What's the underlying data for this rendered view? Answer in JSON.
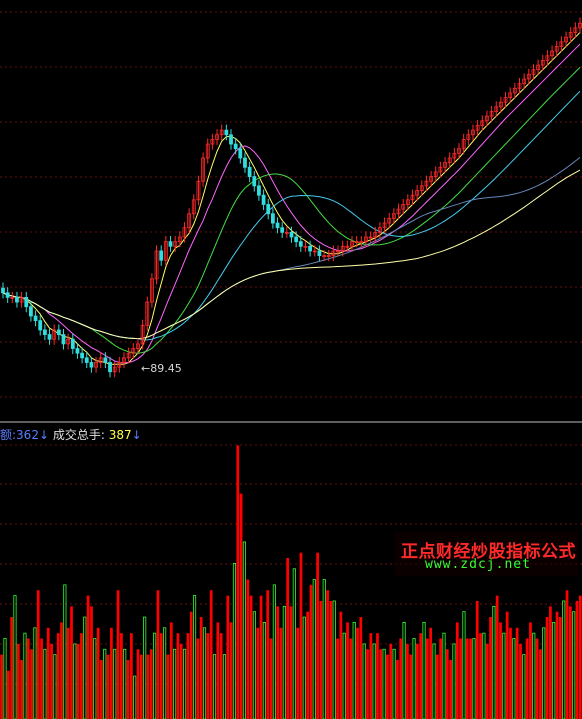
{
  "price_panel": {
    "low_marker": "89.45"
  },
  "volume_panel": {
    "frag_label": "额:",
    "frag_value": "362",
    "total_label": "成交总手:",
    "total_value": "387",
    "arrow": "↓"
  },
  "watermark": {
    "title": "正点财经炒股指标公式",
    "url": "www.zdcj.net"
  },
  "colors": {
    "background": "#000000",
    "up_candle": "#ff2a2a",
    "down_candle": "#33dddd",
    "vol_up": "#ff0000",
    "vol_down_outline": "#33ff33",
    "grid": "#6a1010",
    "divider": "#bbbbbb",
    "ma_white": "#dddddd",
    "ma_yellow": "#ffff66",
    "ma_magenta": "#ff66ff",
    "ma_green": "#44dd44",
    "ma_cyan": "#44ccee",
    "ma_slate": "#6688bb",
    "ma_cream": "#ffffaa"
  },
  "chart_data": [
    {
      "type": "candlestick",
      "title": "",
      "annotations": [
        {
          "text": "89.45",
          "meaning": "period low"
        }
      ],
      "closes": [
        107,
        106,
        106,
        105,
        106,
        104,
        102,
        101,
        99,
        98,
        97,
        99,
        98,
        96,
        97,
        95,
        94,
        93,
        92,
        91,
        92,
        93,
        92,
        90,
        91,
        92,
        93,
        94,
        95,
        96,
        100,
        105,
        110,
        116,
        114,
        118,
        117,
        118,
        119,
        121,
        124,
        127,
        131,
        136,
        139,
        140,
        141,
        142,
        141,
        139,
        138,
        136,
        134,
        132,
        130,
        128,
        126,
        124,
        122,
        121,
        120,
        120,
        119,
        118,
        117,
        117,
        116,
        116,
        115,
        115,
        115,
        116,
        116,
        117,
        117,
        118,
        118,
        118,
        119,
        119,
        120,
        121,
        122,
        123,
        124,
        125,
        126,
        127,
        128,
        129,
        130,
        131,
        132,
        133,
        134,
        135,
        136,
        137,
        138,
        140,
        141,
        142,
        143,
        144,
        145,
        146,
        147,
        148,
        149,
        150,
        151,
        152,
        153,
        154,
        155,
        156,
        157,
        158,
        159,
        160,
        161,
        162,
        163,
        164,
        165
      ]
    },
    {
      "type": "bar",
      "title": "",
      "series_label": "成交总手",
      "latest_value": 387,
      "values": [
        120,
        150,
        90,
        190,
        230,
        140,
        110,
        160,
        150,
        130,
        170,
        240,
        150,
        130,
        170,
        140,
        120,
        160,
        180,
        250,
        170,
        210,
        140,
        140,
        160,
        190,
        230,
        210,
        150,
        170,
        110,
        130,
        120,
        170,
        130,
        240,
        160,
        130,
        110,
        160,
        80,
        130,
        120,
        190,
        120,
        130,
        160,
        240,
        160,
        170,
        120,
        180,
        130,
        160,
        140,
        130,
        160,
        200,
        230,
        150,
        190,
        170,
        160,
        240,
        120,
        180,
        160,
        120,
        230,
        180,
        290,
        510,
        420,
        330,
        260,
        230,
        200,
        170,
        230,
        180,
        240,
        150,
        250,
        210,
        170,
        210,
        300,
        210,
        280,
        170,
        310,
        190,
        200,
        250,
        260,
        310,
        220,
        260,
        240,
        220,
        220,
        150,
        200,
        160,
        180,
        150,
        180,
        170,
        190,
        140,
        130,
        160,
        140,
        160,
        130,
        130,
        120,
        140,
        130,
        110,
        150,
        180,
        140,
        120,
        150,
        140,
        160,
        180,
        150,
        170,
        140,
        120,
        150,
        160,
        130,
        110,
        140,
        180,
        150,
        200,
        150,
        150,
        150,
        220,
        160,
        160,
        140,
        190,
        210,
        230,
        180,
        160,
        200,
        170,
        150,
        170,
        140,
        120,
        150,
        180,
        160,
        150,
        130,
        170,
        190,
        210,
        180,
        200,
        190,
        220,
        240,
        210,
        200,
        220,
        230
      ]
    }
  ]
}
